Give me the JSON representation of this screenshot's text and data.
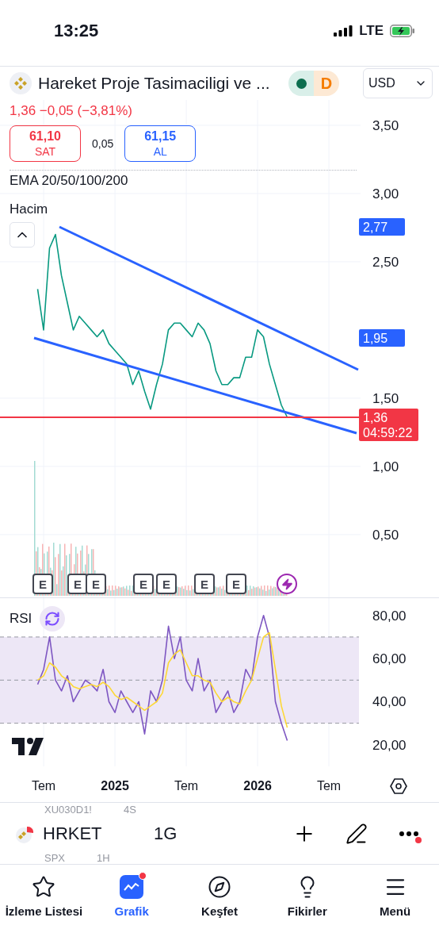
{
  "status_bar": {
    "time": "13:25",
    "network": "LTE"
  },
  "header": {
    "title": "Hareket Proje Tasimaciligi ve ...",
    "session_badge": "D",
    "currency": "USD"
  },
  "quote": {
    "price_change": "1,36 −0,05 (−3,81%)",
    "sell": {
      "price": "61,10",
      "label": "SAT"
    },
    "spread": "0,05",
    "buy": {
      "price": "61,15",
      "label": "AL"
    }
  },
  "indicators": {
    "ema": "EMA 20/50/100/200",
    "volume": "Hacim"
  },
  "price_chart": {
    "chart_data": {
      "type": "line",
      "grid": true,
      "ylim": [
        0.04,
        3.686
      ],
      "series": [
        {
          "color": "#089981",
          "values": [
            2.3,
            2.0,
            2.6,
            2.7,
            2.4,
            2.2,
            2.0,
            2.1,
            2.05,
            2.0,
            1.95,
            2.0,
            1.9,
            1.85,
            1.8,
            1.75,
            1.6,
            1.7,
            1.55,
            1.42,
            1.6,
            1.75,
            2.0,
            2.05,
            2.05,
            2.0,
            1.95,
            2.05,
            2.0,
            1.9,
            1.7,
            1.6,
            1.6,
            1.65,
            1.65,
            1.8,
            1.8,
            2.0,
            1.95,
            1.75,
            1.6,
            1.45,
            1.36
          ]
        }
      ],
      "yticks": [
        {
          "value": 0.5,
          "label": "0,50"
        },
        {
          "value": 1,
          "label": "1,00"
        },
        {
          "value": 1.5,
          "label": "1,50"
        },
        {
          "value": 2.5,
          "label": "2,50"
        },
        {
          "value": 3,
          "label": "3,00"
        },
        {
          "value": 3.5,
          "label": "3,50"
        }
      ],
      "ref_lines": [
        {
          "axis": "y",
          "value": 1.36,
          "label": "1,36",
          "color": "#f23645"
        }
      ]
    },
    "countdown": "04:59:22",
    "price_labels": [
      {
        "text": "2,77",
        "color": "#2962ff"
      },
      {
        "text": "1,95",
        "color": "#2962ff"
      }
    ],
    "events": [
      {
        "kind": "earnings",
        "text": "E"
      },
      {
        "kind": "earnings",
        "text": "E"
      },
      {
        "kind": "earnings",
        "text": "E"
      },
      {
        "kind": "earnings",
        "text": "E"
      },
      {
        "kind": "earnings",
        "text": "E"
      },
      {
        "kind": "earnings",
        "text": "E"
      },
      {
        "kind": "earnings",
        "text": "E"
      },
      {
        "kind": "news"
      }
    ]
  },
  "rsi": {
    "chart_data": {
      "type": "line",
      "grid": true,
      "xlim": [
        2024.194,
        2026.711
      ],
      "ylim": [
        10,
        88
      ],
      "x": [
        2024.458,
        2024.5,
        2024.542,
        2024.583,
        2024.625,
        2024.667,
        2024.708,
        2024.75,
        2024.792,
        2024.833,
        2024.875,
        2024.917,
        2024.958,
        2025.0,
        2025.042,
        2025.083,
        2025.125,
        2025.167,
        2025.208,
        2025.25,
        2025.292,
        2025.333,
        2025.375,
        2025.417,
        2025.458,
        2025.5,
        2025.542,
        2025.583,
        2025.625,
        2025.667,
        2025.708,
        2025.75,
        2025.792,
        2025.833,
        2025.875,
        2025.917,
        2025.958,
        2026.0,
        2026.042,
        2026.083,
        2026.125,
        2026.167,
        2026.208
      ],
      "series": [
        {
          "name": "RSI",
          "color": "#7e57c2",
          "values": [
            48,
            55,
            70,
            50,
            45,
            52,
            40,
            45,
            50,
            48,
            45,
            55,
            40,
            35,
            45,
            40,
            35,
            40,
            25,
            45,
            40,
            50,
            75,
            60,
            70,
            50,
            45,
            60,
            45,
            50,
            35,
            40,
            45,
            35,
            40,
            55,
            50,
            70,
            80,
            70,
            40,
            30,
            22
          ]
        },
        {
          "color": "#fdd835",
          "values": [
            50,
            52,
            58,
            56,
            52,
            50,
            47,
            46,
            47,
            48,
            47,
            49,
            47,
            43,
            41,
            42,
            40,
            38,
            36,
            38,
            40,
            44,
            58,
            62,
            64,
            58,
            52,
            52,
            50,
            49,
            44,
            40,
            42,
            40,
            39,
            45,
            50,
            60,
            70,
            72,
            55,
            38,
            28
          ]
        }
      ],
      "yticks": [
        {
          "value": 20,
          "label": "20,00"
        },
        {
          "value": 40,
          "label": "40,00"
        },
        {
          "value": 60,
          "label": "60,00"
        },
        {
          "value": 80,
          "label": "80,00"
        }
      ],
      "xticks": [
        {
          "value": 2024.5,
          "label": "Tem"
        },
        {
          "value": 2025,
          "label": "2025"
        },
        {
          "value": 2025.5,
          "label": "Tem"
        },
        {
          "value": 2026,
          "label": "2026"
        },
        {
          "value": 2026.5,
          "label": "Tem"
        }
      ],
      "bands": [
        {
          "axis": "y",
          "from": 30,
          "to": 70,
          "color": "#ede7f6"
        }
      ]
    }
  },
  "symbol_bar": {
    "above": {
      "symbol": "XU030D1!",
      "interval": "4S"
    },
    "symbol": "HRKET",
    "interval": "1G",
    "below": {
      "symbol": "SPX",
      "interval": "1H"
    },
    "more_notification": true
  },
  "tabs": [
    {
      "label": "İzleme Listesi",
      "kind": "watchlist",
      "selected": false,
      "notification": false
    },
    {
      "label": "Grafik",
      "kind": "chart",
      "selected": true,
      "notification": true
    },
    {
      "label": "Keşfet",
      "kind": "explore",
      "selected": false,
      "notification": false
    },
    {
      "label": "Fikirler",
      "kind": "ideas",
      "selected": false,
      "notification": false
    },
    {
      "label": "Menü",
      "kind": "menu",
      "selected": false,
      "notification": false
    }
  ]
}
